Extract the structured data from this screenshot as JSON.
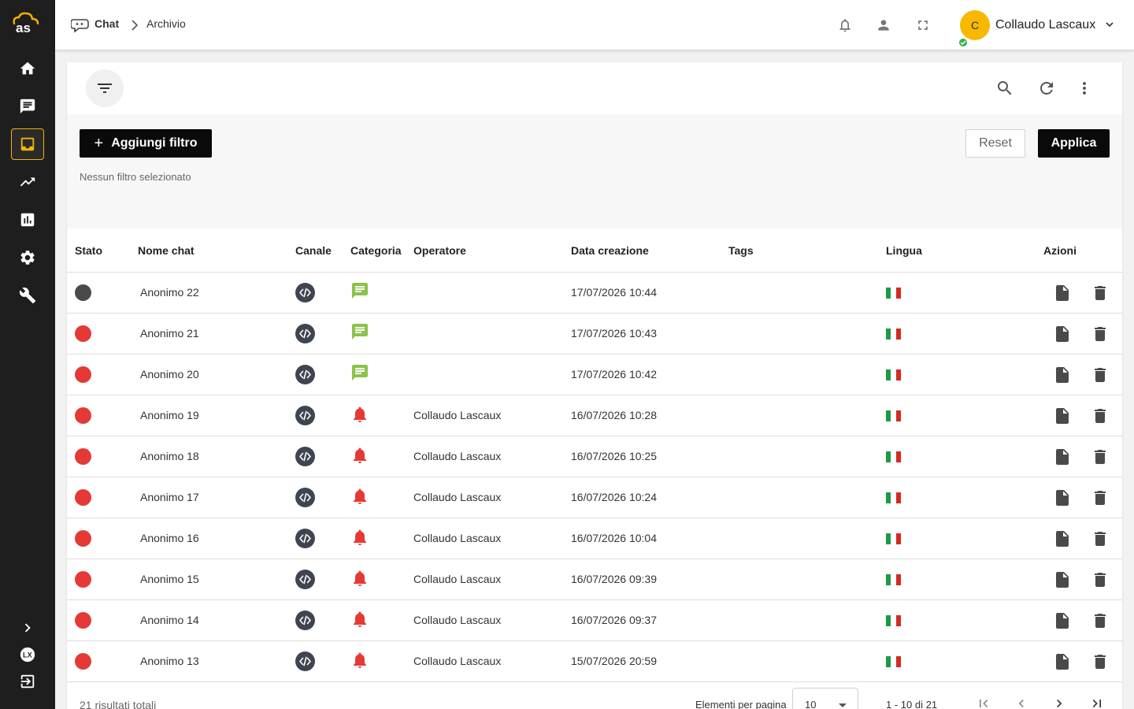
{
  "breadcrumb": {
    "section": "Chat",
    "page": "Archivio"
  },
  "user": {
    "initial": "C",
    "name": "Collaudo Lascaux",
    "status": "online"
  },
  "sidebar": {
    "logo": "as",
    "items": [
      {
        "icon": "home-icon",
        "active": false
      },
      {
        "icon": "chat-icon",
        "active": false
      },
      {
        "icon": "inbox-icon",
        "active": true
      },
      {
        "icon": "trending-icon",
        "active": false
      },
      {
        "icon": "bar-chart-icon",
        "active": false
      },
      {
        "icon": "gear-icon",
        "active": false
      },
      {
        "icon": "wrench-icon",
        "active": false
      }
    ],
    "bottom": [
      "expand-chevron-icon",
      "lx-icon",
      "logout-icon"
    ]
  },
  "filters": {
    "add_label": "Aggiungi filtro",
    "reset_label": "Reset",
    "apply_label": "Applica",
    "empty_text": "Nessun filtro selezionato"
  },
  "table": {
    "headers": {
      "stato": "Stato",
      "nome": "Nome chat",
      "canale": "Canale",
      "categoria": "Categoria",
      "operatore": "Operatore",
      "data": "Data creazione",
      "tags": "Tags",
      "lingua": "Lingua",
      "azioni": "Azioni"
    },
    "rows": [
      {
        "stato": "closed",
        "nome": "Anonimo 22",
        "canale": "web-code-icon",
        "categoria": "chat",
        "operatore": "",
        "data": "17/07/2026 10:44",
        "tags": "",
        "lingua": "it"
      },
      {
        "stato": "unread",
        "nome": "Anonimo 21",
        "canale": "web-code-icon",
        "categoria": "chat",
        "operatore": "",
        "data": "17/07/2026 10:43",
        "tags": "",
        "lingua": "it"
      },
      {
        "stato": "unread",
        "nome": "Anonimo 20",
        "canale": "web-code-icon",
        "categoria": "chat",
        "operatore": "",
        "data": "17/07/2026 10:42",
        "tags": "",
        "lingua": "it"
      },
      {
        "stato": "unread",
        "nome": "Anonimo 19",
        "canale": "web-code-icon",
        "categoria": "alert",
        "operatore": "Collaudo Lascaux",
        "data": "16/07/2026 10:28",
        "tags": "",
        "lingua": "it"
      },
      {
        "stato": "unread",
        "nome": "Anonimo 18",
        "canale": "web-code-icon",
        "categoria": "alert",
        "operatore": "Collaudo Lascaux",
        "data": "16/07/2026 10:25",
        "tags": "",
        "lingua": "it"
      },
      {
        "stato": "unread",
        "nome": "Anonimo 17",
        "canale": "web-code-icon",
        "categoria": "alert",
        "operatore": "Collaudo Lascaux",
        "data": "16/07/2026 10:24",
        "tags": "",
        "lingua": "it"
      },
      {
        "stato": "unread",
        "nome": "Anonimo 16",
        "canale": "web-code-icon",
        "categoria": "alert",
        "operatore": "Collaudo Lascaux",
        "data": "16/07/2026 10:04",
        "tags": "",
        "lingua": "it"
      },
      {
        "stato": "unread",
        "nome": "Anonimo 15",
        "canale": "web-code-icon",
        "categoria": "alert",
        "operatore": "Collaudo Lascaux",
        "data": "16/07/2026 09:39",
        "tags": "",
        "lingua": "it"
      },
      {
        "stato": "unread",
        "nome": "Anonimo 14",
        "canale": "web-code-icon",
        "categoria": "alert",
        "operatore": "Collaudo Lascaux",
        "data": "16/07/2026 09:37",
        "tags": "",
        "lingua": "it"
      },
      {
        "stato": "unread",
        "nome": "Anonimo 13",
        "canale": "web-code-icon",
        "categoria": "alert",
        "operatore": "Collaudo Lascaux",
        "data": "15/07/2026 20:59",
        "tags": "",
        "lingua": "it"
      }
    ]
  },
  "pagination": {
    "total_count": "21",
    "total_suffix": "risultati totali",
    "per_page_label": "Elementi per pagina",
    "per_page_value": "10",
    "range": "1 - 10 di 21"
  },
  "colors": {
    "accent": "#f5b300",
    "sidebar_bg": "#1e1e1e",
    "status_unread": "#e53935",
    "status_closed": "#4a4a4a",
    "category_chat": "#8bc34a",
    "category_alert": "#e53935",
    "online": "#36b24a"
  }
}
